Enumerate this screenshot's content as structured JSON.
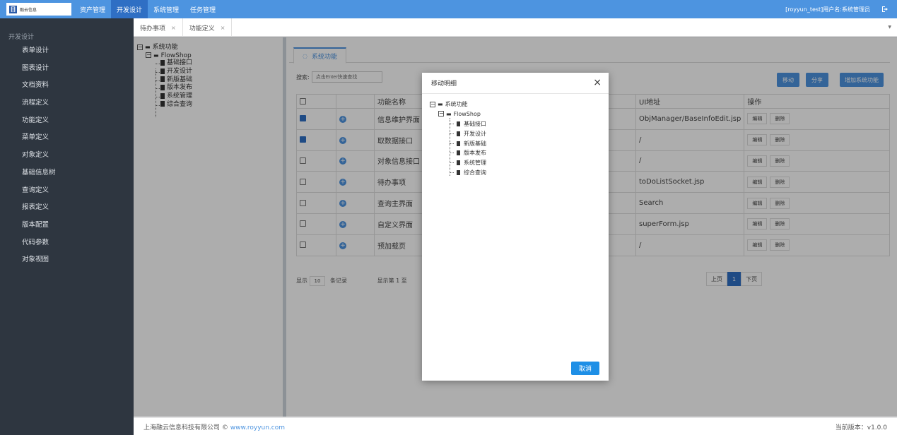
{
  "header": {
    "logo_mark": "日",
    "logo_text": "融云信息",
    "nav": [
      "资产管理",
      "开发设计",
      "系统管理",
      "任务管理"
    ],
    "active_nav": 1,
    "user": "[royyun_test]用户名:系统管理员",
    "logout_icon": "logout-icon"
  },
  "sidebar": {
    "title": "开发设计",
    "items": [
      "表单设计",
      "图表设计",
      "文档资料",
      "流程定义",
      "功能定义",
      "菜单定义",
      "对象定义",
      "基础信息树",
      "查询定义",
      "报表定义",
      "版本配置",
      "代码参数",
      "对象视图"
    ]
  },
  "tabs": [
    {
      "label": "待办事项",
      "close": "×"
    },
    {
      "label": "功能定义",
      "close": "×"
    }
  ],
  "tree": {
    "root": "系统功能",
    "child": "FlowShop",
    "leaves": [
      "基础接口",
      "开发设计",
      "新版基础",
      "版本发布",
      "系统管理",
      "综合查询"
    ]
  },
  "panel": {
    "tab_label": "系统功能",
    "search_label": "搜索:",
    "search_placeholder": "点击Enter快速查找",
    "buttons": {
      "move": "移动",
      "share": "分享",
      "add": "增加系统功能"
    },
    "columns": {
      "name": "功能名称",
      "url": "UI地址",
      "ops": "操作"
    },
    "rows": [
      {
        "checked": true,
        "name": "信息维护界面",
        "url": "ObjManager/BaseInfoEdit.jsp"
      },
      {
        "checked": true,
        "name": "取数据接口",
        "url": "/"
      },
      {
        "checked": false,
        "name": "对象信息接口",
        "url": "/"
      },
      {
        "checked": false,
        "name": "待办事项",
        "url": "toDoListSocket.jsp"
      },
      {
        "checked": false,
        "name": "查询主界面",
        "url": "Search"
      },
      {
        "checked": false,
        "name": "自定义界面",
        "url": "superForm.jsp"
      },
      {
        "checked": false,
        "name": "预加载页",
        "url": "/"
      }
    ],
    "edit_label": "编辑",
    "delete_label": "删除",
    "show_label": "显示",
    "page_size": "10",
    "records_label": "条记录",
    "summary": "显示第 1 至",
    "prev": "上页",
    "page": "1",
    "next": "下页"
  },
  "modal": {
    "title": "移动明细",
    "close": "×",
    "cancel": "取消"
  },
  "footer": {
    "company": "上海融云信息科技有限公司 ©",
    "link": "www.royyun.com",
    "version": "当前版本：v1.0.0"
  }
}
